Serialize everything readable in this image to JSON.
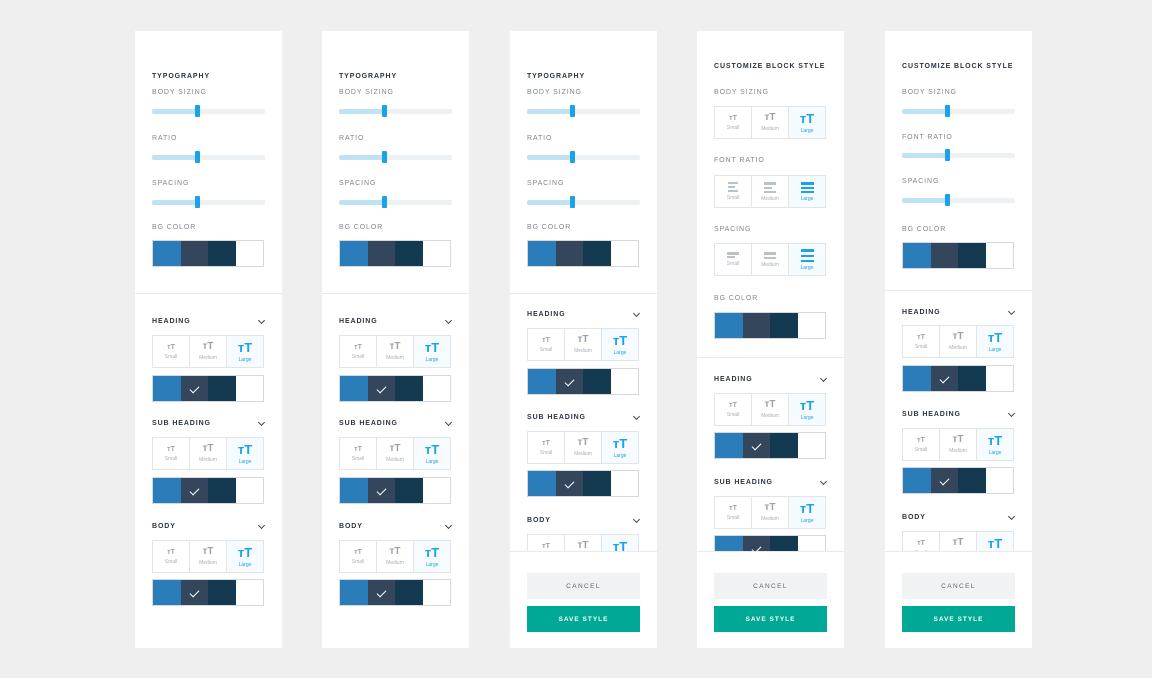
{
  "colors": {
    "swatches": [
      "#2a7db8",
      "#34465c",
      "#143a52",
      "#ffffff"
    ],
    "accent": "#1aa3e8",
    "save": "#00a896"
  },
  "labels": {
    "typography": "TYPOGRAPHY",
    "customize": "CUSTOMIZE BLOCK STYLE",
    "body_sizing": "BODY SIZING",
    "ratio": "RATIO",
    "font_ratio": "FONT RATIO",
    "spacing": "SPACING",
    "bg_color": "BG COLOR",
    "heading": "HEADING",
    "sub_heading": "SUB HEADING",
    "body": "BODY",
    "tt_small": "тT",
    "tt_medium": "тT",
    "tt_large": "тT",
    "small": "Small",
    "medium": "Medium",
    "large": "Large",
    "cancel": "CANCEL",
    "save": "SAVE STYLE"
  },
  "sliders": {
    "body_sizing": 0.4,
    "ratio": 0.4,
    "spacing": 0.4
  },
  "selected": {
    "size": "Large",
    "color_index": 1
  },
  "icons": [
    "chevron-down-icon",
    "check-icon",
    "text-size-icon",
    "text-lines-icon"
  ]
}
